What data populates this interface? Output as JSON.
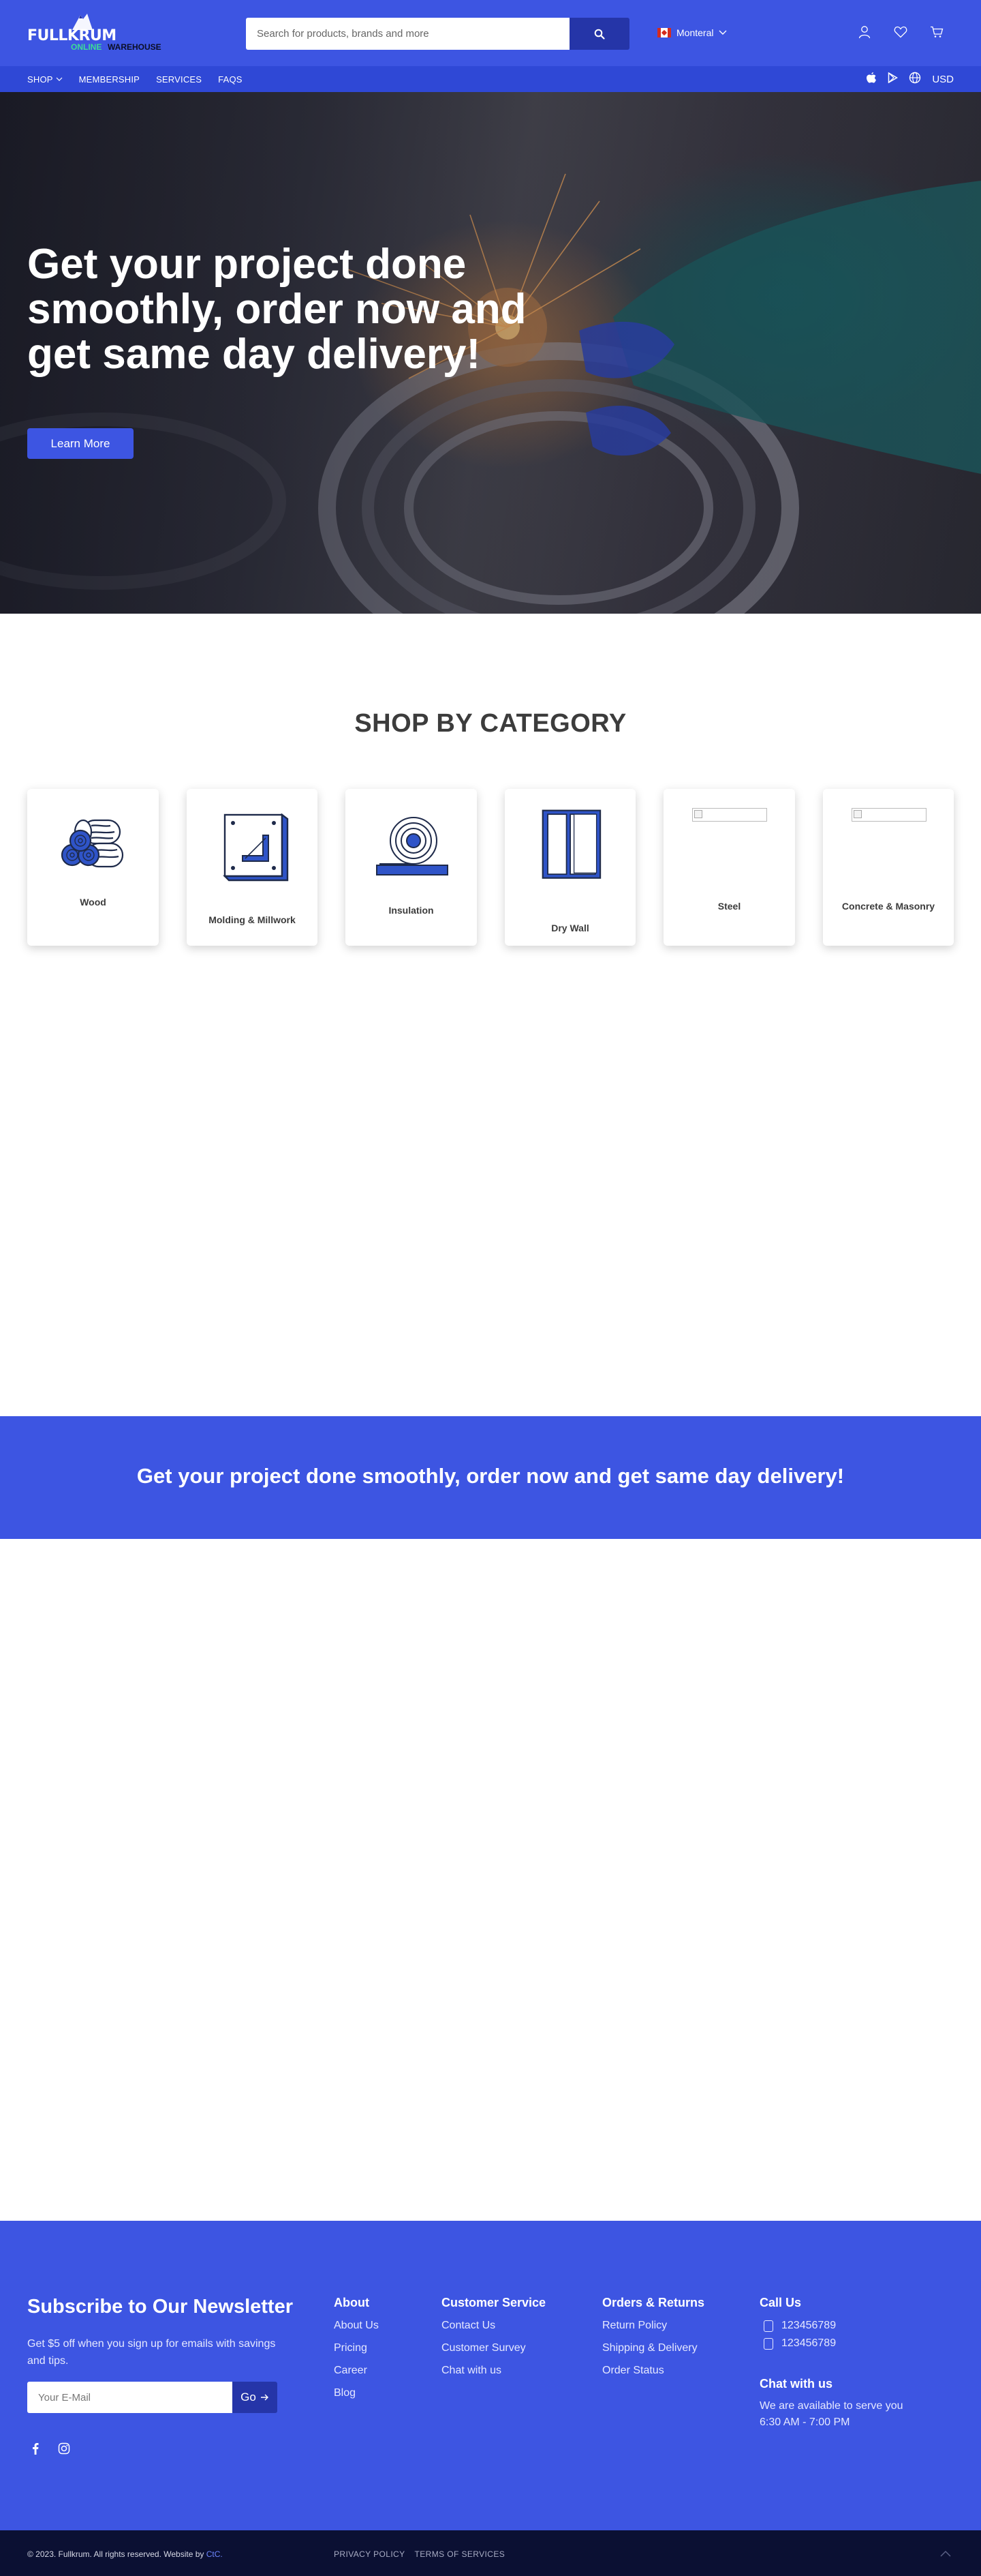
{
  "brand": {
    "name": "FULLKRUM",
    "tagline_1": "ONLINE",
    "tagline_2": "WAREHOUSE"
  },
  "search": {
    "placeholder": "Search for products, brands and more"
  },
  "location": {
    "city": "Monteral"
  },
  "nav": {
    "items": [
      "SHOP",
      "MEMBERSHIP",
      "SERVICES",
      "FAQS"
    ],
    "currency": "USD"
  },
  "hero": {
    "title": "Get your project done smoothly, order now and get same day delivery!",
    "button": "Learn More"
  },
  "categories": {
    "title": "SHOP BY CATEGORY",
    "items": [
      {
        "label": "Wood",
        "icon": "logs-icon"
      },
      {
        "label": "Molding & Millwork",
        "icon": "molding-icon"
      },
      {
        "label": "Insulation",
        "icon": "insulation-roll-icon"
      },
      {
        "label": "Dry Wall",
        "icon": "drywall-icon"
      },
      {
        "label": "Steel",
        "icon": "broken-image"
      },
      {
        "label": "Concrete & Masonry",
        "icon": "broken-image"
      }
    ]
  },
  "banner": {
    "text": "Get your project done smoothly, order now and get same day delivery!"
  },
  "footer": {
    "newsletter": {
      "title": "Subscribe to Our Newsletter",
      "desc": "Get $5 off when you sign up for emails with savings and tips.",
      "placeholder": "Your E-Mail",
      "button": "Go"
    },
    "about": {
      "title": "About",
      "links": [
        "About Us",
        "Pricing",
        "Career",
        "Blog"
      ]
    },
    "customer_service": {
      "title": "Customer Service",
      "links": [
        "Contact Us",
        "Customer Survey",
        "Chat with us"
      ]
    },
    "orders": {
      "title": "Orders & Returns",
      "links": [
        "Return Policy",
        "Shipping & Delivery",
        "Order Status"
      ]
    },
    "call": {
      "title": "Call Us",
      "phones": [
        "123456789",
        "123456789"
      ]
    },
    "chat": {
      "title": "Chat with us",
      "text": "We are available to serve you 6:30 AM - 7:00 PM"
    },
    "copyright": "© 2023. Fullkrum. All rights reserved. Website by",
    "credit": "CtC.",
    "legal": [
      "PRIVACY POLICY",
      "TERMS OF SERVICES"
    ]
  },
  "colors": {
    "primary": "#3d55e2",
    "nav": "#2f48d6",
    "dark": "#0b1033",
    "accent_green": "#3ddc97"
  }
}
